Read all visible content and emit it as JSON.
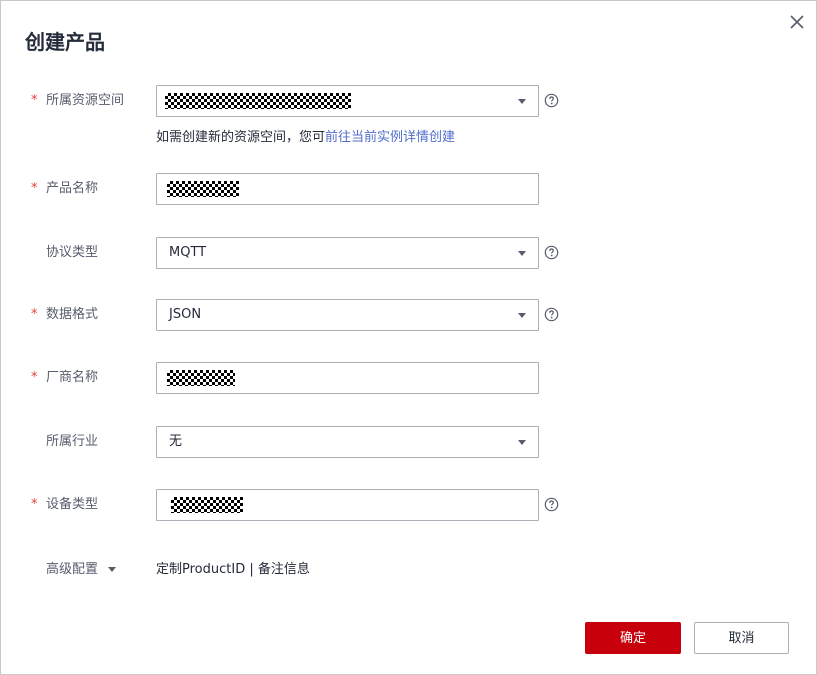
{
  "dialog": {
    "title": "创建产品",
    "close_icon": "close-icon",
    "help_icon": "question-circle-icon"
  },
  "form": {
    "resource_space": {
      "required": true,
      "label": "所属资源空间",
      "hint_text": "如需创建新的资源空间，您可",
      "hint_link": "前往当前实例详情创建"
    },
    "product_name": {
      "required": true,
      "label": "产品名称"
    },
    "protocol": {
      "required": false,
      "label": "协议类型",
      "value": "MQTT"
    },
    "data_format": {
      "required": true,
      "label": "数据格式",
      "value": "JSON"
    },
    "manufacturer": {
      "required": true,
      "label": "厂商名称"
    },
    "industry": {
      "required": false,
      "label": "所属行业",
      "value": "无"
    },
    "device_type": {
      "required": true,
      "label": "设备类型"
    },
    "advanced": {
      "label": "高级配置",
      "items": "定制ProductID | 备注信息"
    }
  },
  "required_mark": "*",
  "buttons": {
    "ok": "确定",
    "cancel": "取消"
  },
  "colors": {
    "primary": "#c7000b",
    "link": "#526ecc",
    "required": "#e8413a",
    "border": "#adb0b8"
  }
}
